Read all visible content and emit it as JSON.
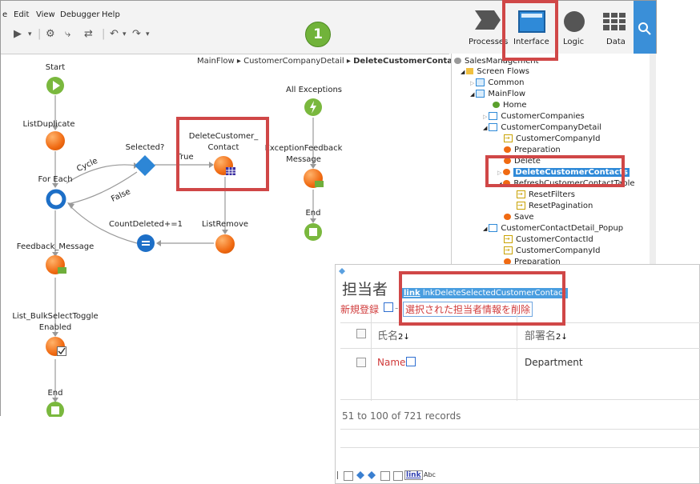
{
  "menu": [
    "e",
    "Edit",
    "View",
    "Debugger",
    "Help"
  ],
  "badge": "1",
  "tabs": [
    {
      "label": "Processes"
    },
    {
      "label": "Interface"
    },
    {
      "label": "Logic"
    },
    {
      "label": "Data"
    }
  ],
  "breadcrumb": {
    "parts": [
      "MainFlow",
      "CustomerCompanyDetail"
    ],
    "current": "DeleteCustomerContacts"
  },
  "flow": {
    "start": "Start",
    "list_duplicate": "ListDuplicate",
    "for_each": "For Each",
    "cycle": "Cycle",
    "false_label": "False",
    "selected": "Selected?",
    "true_label": "True",
    "delete_node": [
      "DeleteCustomer_",
      "Contact"
    ],
    "list_remove": "ListRemove",
    "count_deleted": "CountDeleted+=1",
    "feedback_message": "Feedback_Message",
    "list_bulk": [
      "List_BulkSelectToggle",
      "Enabled"
    ],
    "end": "End",
    "all_exceptions": "All Exceptions",
    "exception_feedback": [
      "ExceptionFeedback",
      "Message"
    ],
    "exc_end": "End"
  },
  "tree": [
    {
      "label": "SalesManagement"
    },
    {
      "label": "Screen Flows"
    },
    {
      "label": "Common"
    },
    {
      "label": "MainFlow"
    },
    {
      "label": "Home"
    },
    {
      "label": "CustomerCompanies"
    },
    {
      "label": "CustomerCompanyDetail"
    },
    {
      "label": "CustomerCompanyId"
    },
    {
      "label": "Preparation"
    },
    {
      "label": "Delete"
    },
    {
      "label": "DeleteCustomerContacts"
    },
    {
      "label": "RefreshCustomerContactTable"
    },
    {
      "label": "ResetFilters"
    },
    {
      "label": "ResetPagination"
    },
    {
      "label": "Save"
    },
    {
      "label": "CustomerContactDetail_Popup"
    },
    {
      "label": "CustomerContactId"
    },
    {
      "label": "CustomerCompanyId"
    },
    {
      "label": "Preparation"
    }
  ],
  "panel": {
    "title": "担当者",
    "link_widget": "lnkDeleteSelectedCustomerContact",
    "link_tag": "link",
    "new_link": "新規登録",
    "delete_link": "選択された担当者情報を削除",
    "col_name": "氏名",
    "col_dept": "部署名",
    "row_name": "Name",
    "row_dept": "Department",
    "records": "51 to 100 of 721 records",
    "bottom_link": "link",
    "bottom_abc": "Abc"
  }
}
